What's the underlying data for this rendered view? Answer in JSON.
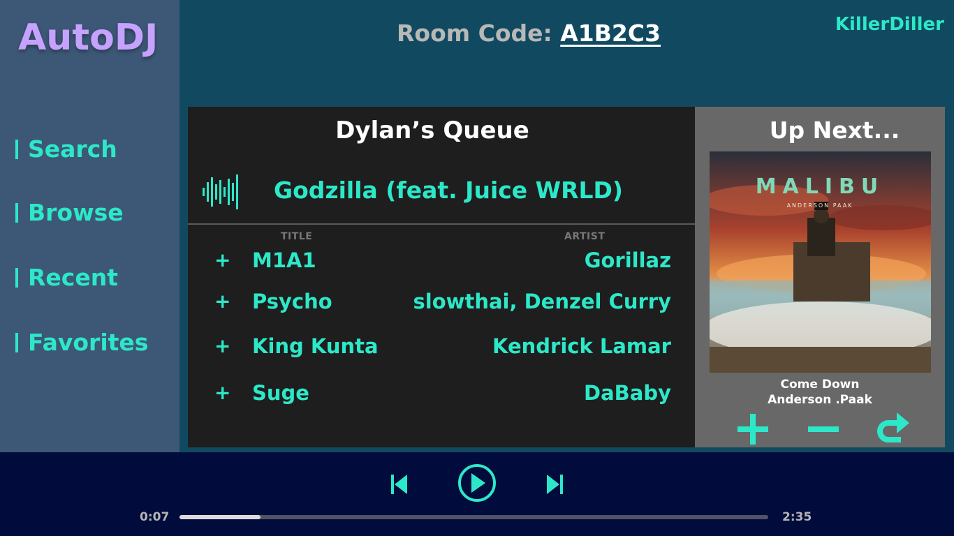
{
  "app": {
    "title": "AutoDJ"
  },
  "sidebar": {
    "items": [
      {
        "label": "Search"
      },
      {
        "label": "Browse"
      },
      {
        "label": "Recent"
      },
      {
        "label": "Favorites"
      }
    ]
  },
  "header": {
    "room_label": "Room Code: ",
    "room_code": "A1B2C3",
    "username": "KillerDiller"
  },
  "queue": {
    "title": "Dylan’s Queue",
    "now_playing": "Godzilla (feat. Juice WRLD)",
    "columns": {
      "title": "TITLE",
      "artist": "ARTIST"
    },
    "add_symbol": "+",
    "rows": [
      {
        "title": "M1A1",
        "artist": "Gorillaz"
      },
      {
        "title": "Psycho",
        "artist": "slowthai, Denzel Curry"
      },
      {
        "title": "King Kunta",
        "artist": "Kendrick Lamar"
      },
      {
        "title": "Suge",
        "artist": "DaBaby"
      }
    ]
  },
  "up_next": {
    "title": "Up Next...",
    "cover_title": "MALIBU",
    "cover_artist": "ANDERSON PAAK",
    "song": "Come Down",
    "artist": "Anderson .Paak"
  },
  "player": {
    "elapsed": "0:07",
    "duration": "2:35",
    "progress_fraction": 0.138
  },
  "colors": {
    "accent": "#2de8c8",
    "logo": "#c6a2ff",
    "sidebar": "#3d5877",
    "background": "#114a60",
    "queue_panel": "#1e1e1e",
    "upnext_panel": "#686868",
    "player_bar": "#020c3c"
  },
  "icons": {
    "now_playing": "sound-wave-icon",
    "add": "plus-icon",
    "remove": "minus-icon",
    "skip": "redo-arrow-icon",
    "previous": "skip-previous-icon",
    "play": "play-circle-icon",
    "next": "skip-next-icon"
  }
}
